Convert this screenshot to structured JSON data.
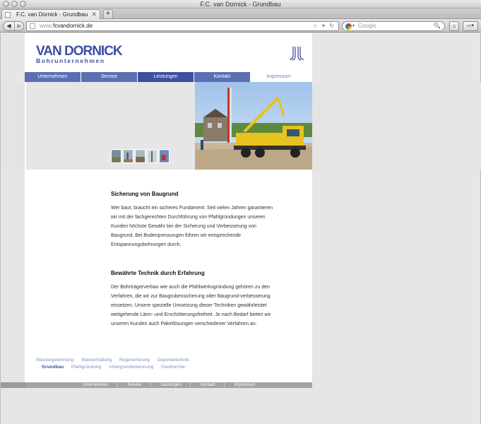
{
  "window": {
    "title": "F.C. van Dornick - Grundbau"
  },
  "tab": {
    "label": "F.C. van Dornick - Grundbau",
    "close": "✕",
    "new": "+"
  },
  "nav": {
    "back": "◀",
    "forward": "▶"
  },
  "address": {
    "scheme": "www.",
    "host": "fcvandornick.de",
    "tools": "☆ ▾ ↻"
  },
  "search": {
    "placeholder": "Google",
    "caret": "▾",
    "mag": "🔍"
  },
  "buttons": {
    "home": "⌂",
    "bookmarks": "▭▾"
  },
  "logo": {
    "main": "VAN DORNICK",
    "sub": "Bohrunternehmen"
  },
  "topnav": [
    "Unternehmen",
    "Service",
    "Leistungen",
    "Kontakt",
    "Impressum"
  ],
  "sections": [
    {
      "heading": "Sicherung von Baugrund",
      "body": "Wer baut, braucht ein sicheres Fundament. Seit vielen Jahren garantieren wir mit der fachgerechten Durchführung von Pfahlgründungen unseren Kunden höchste Gewähr bei der Sicherung und Verbesserung von Baugrund. Bei Bodenpressungen führen wir entsprechende Entspannungsbohrungen durch."
    },
    {
      "heading": "Bewährte Technik durch Erfahrung",
      "body": "Der Bohrträgerverbau wie auch die Pfahlwerksgründung gehören zu den Verfahren, die wir zur Baugrubensicherung oder Baugrund-verbesserung einsetzen. Unsere spezielle Umsetzung dieser Techniken gewährleistet weitgehende Lärm- und Erschütterungsfreiheit. Je nach Bedarf bieten wir unseren Kunden auch Paketlösungen verschiedener Verfahren an."
    }
  ],
  "footer_links": {
    "row1": [
      "Wassergewinnung",
      "Wasserhaltung",
      "Regenerierung",
      "Deponietechnik"
    ],
    "row2": [
      "Grundbau",
      "Pfahlgründung",
      "Untergrunderkennung",
      "Geothermie"
    ]
  },
  "bottom_nav": [
    "Unternehmen",
    "Service",
    "Leistungen",
    "Kontakt",
    "Impressum"
  ],
  "colors": {
    "brand": "#3c4fa0",
    "nav": "#5a6fb3",
    "link": "#7b8fc8"
  }
}
